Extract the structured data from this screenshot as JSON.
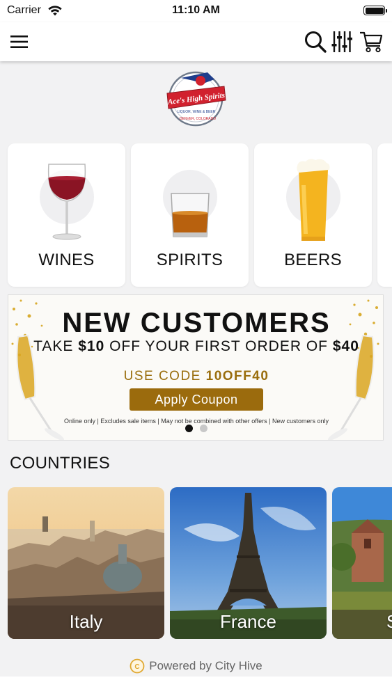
{
  "status_bar": {
    "carrier": "Carrier",
    "time": "11:10 AM"
  },
  "nav": {
    "icons": [
      "menu-icon",
      "search-icon",
      "filter-icon",
      "cart-icon"
    ]
  },
  "logo": {
    "text": "Ace's High Spirits",
    "subtext": "LIQUOR, WINE & BEER",
    "city": "DENVER, COLORADO"
  },
  "categories": [
    {
      "label": "WINES",
      "icon": "wine-glass-icon"
    },
    {
      "label": "SPIRITS",
      "icon": "whiskey-glass-icon"
    },
    {
      "label": "BEERS",
      "icon": "beer-glass-icon"
    }
  ],
  "promo": {
    "title": "NEW CUSTOMERS",
    "subtitle_prefix": "TAKE ",
    "discount": "$10",
    "subtitle_middle": " OFF YOUR FIRST ORDER OF ",
    "minimum": "$40",
    "code_prefix": "USE CODE ",
    "code": "10OFF40",
    "button": "Apply Coupon",
    "disclaimer": "Online only | Excludes sale items | May not be combined with other offers | New customers only",
    "accent_color": "#9b6b0d",
    "slide_count": 2,
    "active_slide": 1
  },
  "countries": {
    "title": "COUNTRIES",
    "items": [
      {
        "label": "Italy"
      },
      {
        "label": "France"
      },
      {
        "label": "S"
      }
    ]
  },
  "footer": {
    "powered_by": "Powered by City Hive"
  }
}
